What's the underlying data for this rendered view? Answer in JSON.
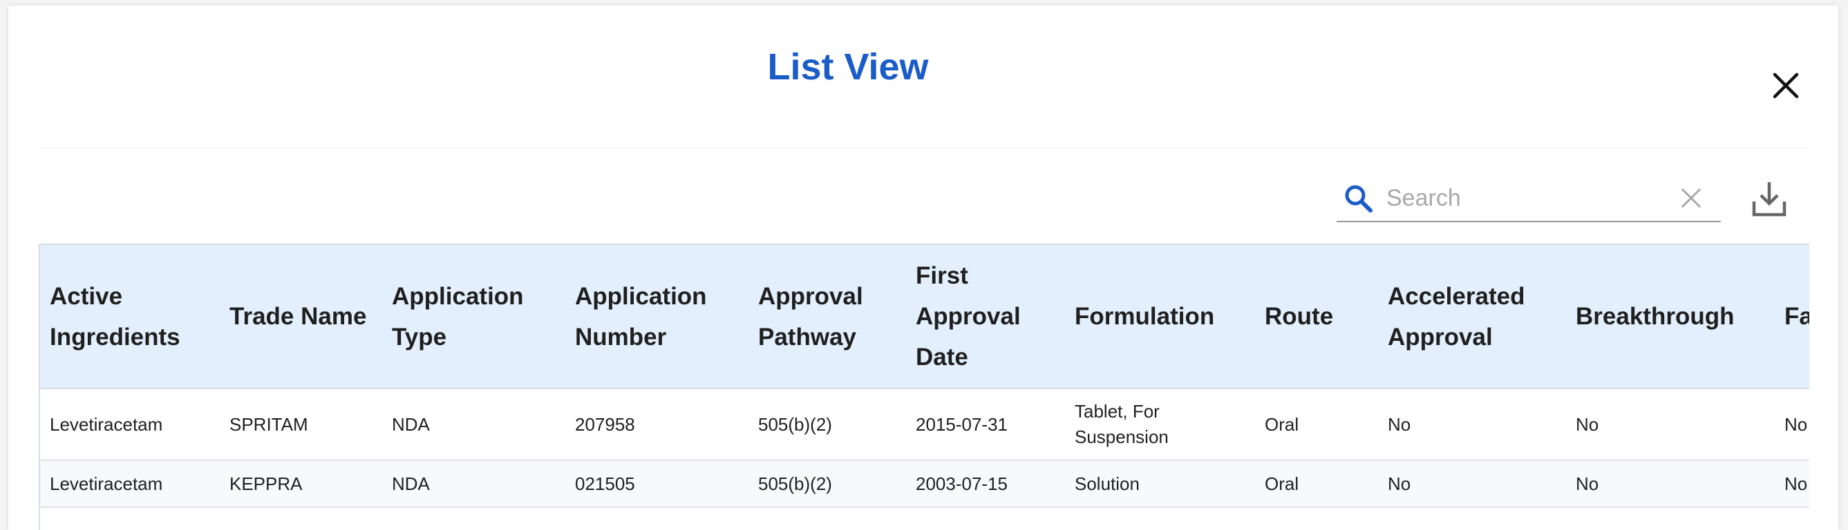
{
  "modal": {
    "title": "List View"
  },
  "search": {
    "placeholder": "Search",
    "value": ""
  },
  "icons": {
    "close": "close-icon",
    "search": "search-icon",
    "clear": "clear-icon",
    "download": "download-icon"
  },
  "colors": {
    "title": "#1a5cc8",
    "header_bg": "#e3effc",
    "search_icon": "#1a5cc8"
  },
  "table": {
    "columns": [
      "Active Ingredients",
      "Trade Name",
      "Application Type",
      "Application Number",
      "Approval Pathway",
      "First Approval Date",
      "Formulation",
      "Route",
      "Accelerated Approval",
      "Breakthrough",
      "Fa"
    ],
    "rows": [
      [
        "Levetiracetam",
        "SPRITAM",
        "NDA",
        "207958",
        "505(b)(2)",
        "2015-07-31",
        "Tablet, For Suspension",
        "Oral",
        "No",
        "No",
        "No"
      ],
      [
        "Levetiracetam",
        "KEPPRA",
        "NDA",
        "021505",
        "505(b)(2)",
        "2003-07-15",
        "Solution",
        "Oral",
        "No",
        "No",
        "No"
      ],
      [
        "",
        "",
        "",
        "",
        "",
        "",
        "",
        "",
        "",
        "",
        ""
      ]
    ]
  }
}
